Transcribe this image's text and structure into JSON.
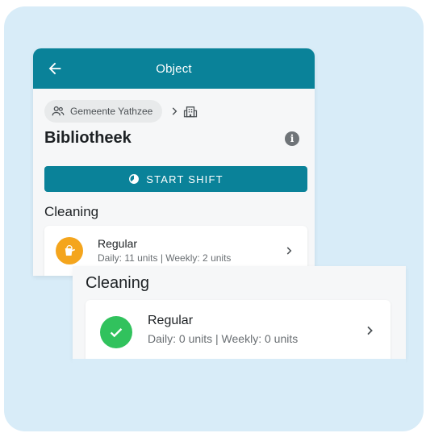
{
  "header": {
    "title": "Object"
  },
  "breadcrumb": {
    "parent": "Gemeente Yathzee"
  },
  "page": {
    "title": "Bibliotheek"
  },
  "actions": {
    "start_shift": "START SHIFT"
  },
  "section": {
    "title": "Cleaning"
  },
  "task_small": {
    "label": "Regular",
    "detail": "Daily: 11 units | Weekly: 2 units",
    "status_color": "#f4a51d"
  },
  "zoom": {
    "section_title": "Cleaning",
    "task": {
      "label": "Regular",
      "detail": "Daily: 0 units | Weekly: 0 units",
      "status_color": "#31c25d"
    }
  },
  "colors": {
    "primary": "#0a8299",
    "backdrop": "#d8ecf8"
  }
}
